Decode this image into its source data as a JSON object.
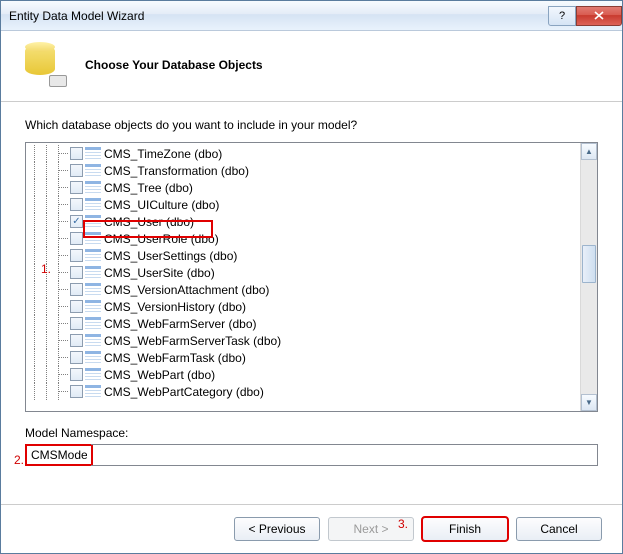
{
  "window": {
    "title": "Entity Data Model Wizard"
  },
  "header": {
    "heading": "Choose Your Database Objects"
  },
  "prompt": "Which database objects do you want to include in your model?",
  "tree": {
    "items": [
      {
        "label": "CMS_TimeZone (dbo)",
        "checked": false
      },
      {
        "label": "CMS_Transformation (dbo)",
        "checked": false
      },
      {
        "label": "CMS_Tree (dbo)",
        "checked": false
      },
      {
        "label": "CMS_UICulture (dbo)",
        "checked": false
      },
      {
        "label": "CMS_User (dbo)",
        "checked": true
      },
      {
        "label": "CMS_UserRole (dbo)",
        "checked": false
      },
      {
        "label": "CMS_UserSettings (dbo)",
        "checked": false
      },
      {
        "label": "CMS_UserSite (dbo)",
        "checked": false
      },
      {
        "label": "CMS_VersionAttachment (dbo)",
        "checked": false
      },
      {
        "label": "CMS_VersionHistory (dbo)",
        "checked": false
      },
      {
        "label": "CMS_WebFarmServer (dbo)",
        "checked": false
      },
      {
        "label": "CMS_WebFarmServerTask (dbo)",
        "checked": false
      },
      {
        "label": "CMS_WebFarmTask (dbo)",
        "checked": false
      },
      {
        "label": "CMS_WebPart (dbo)",
        "checked": false
      },
      {
        "label": "CMS_WebPartCategory (dbo)",
        "checked": false
      }
    ]
  },
  "namespace": {
    "label": "Model Namespace:",
    "value": "CMSModel"
  },
  "buttons": {
    "previous": "< Previous",
    "next": "Next >",
    "finish": "Finish",
    "cancel": "Cancel"
  },
  "annotations": {
    "a1": "1.",
    "a2": "2.",
    "a3": "3."
  }
}
